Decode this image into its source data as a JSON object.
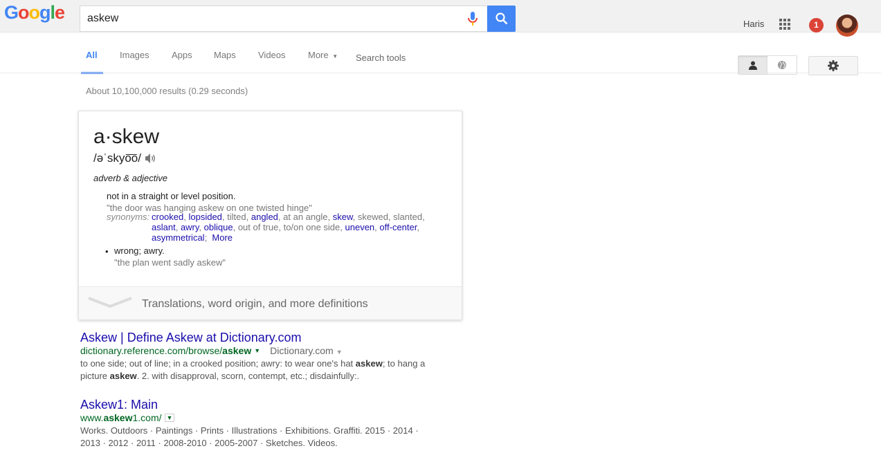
{
  "header": {
    "logo": "Google",
    "query": "askew",
    "user_name": "Haris",
    "notification_count": "1"
  },
  "nav": {
    "tabs": [
      "All",
      "Images",
      "Apps",
      "Maps",
      "Videos",
      "More",
      "Search tools"
    ],
    "active_tab": "All"
  },
  "results_stats": "About 10,100,000 results (0.29 seconds)",
  "dictionary": {
    "word": "a·skew",
    "phonetic": "/əˈskyo͞o/",
    "part_of_speech": "adverb & adjective",
    "definition1": "not in a straight or level position.",
    "example1": "\"the door was hanging askew on one twisted hinge\"",
    "synonyms_label": "synonyms:",
    "synonyms_links": [
      "crooked",
      "lopsided",
      "angled",
      "skew",
      "aslant",
      "awry",
      "oblique",
      "uneven",
      "off-center",
      "asymmetrical"
    ],
    "synonyms_plain": [
      "tilted",
      "at an angle",
      "skewed, slanted",
      "out of true, to/on one side"
    ],
    "synonyms_more": "More",
    "definition2": "wrong; awry.",
    "example2": "\"the plan went sadly askew\"",
    "footer_link": "Translations, word origin, and more definitions"
  },
  "results": [
    {
      "title": "Askew | Define Askew at Dictionary.com",
      "url_pre": "dictionary.reference.com/browse/",
      "url_bold": "askew",
      "source": "Dictionary.com",
      "snippet_a": "to one side; out of line; in a crooked position; awry: to wear one's hat ",
      "snippet_b": "askew",
      "snippet_c": "; to hang a picture ",
      "snippet_d": "askew",
      "snippet_e": ". 2. with disapproval, scorn, contempt, etc.; disdainfully:."
    },
    {
      "title": "Askew1: Main",
      "url_pre": "www.",
      "url_bold": "askew",
      "url_post": "1.com/",
      "snippet": "Works. Outdoors · Paintings · Prints · Illustrations · Exhibitions. Graffiti. 2015 · 2014 · 2013 · 2012 · 2011 · 2008-2010 · 2005-2007 · Sketches. Videos."
    }
  ],
  "colors": {
    "accent": "#4285f4",
    "link": "#1a0dab",
    "url_green": "#006621",
    "badge_red": "#db4437"
  },
  "icons": [
    "mic-icon",
    "search-icon",
    "apps-grid-icon",
    "person-icon",
    "globe-icon",
    "gear-icon",
    "speaker-icon",
    "chevron-down-icon"
  ]
}
